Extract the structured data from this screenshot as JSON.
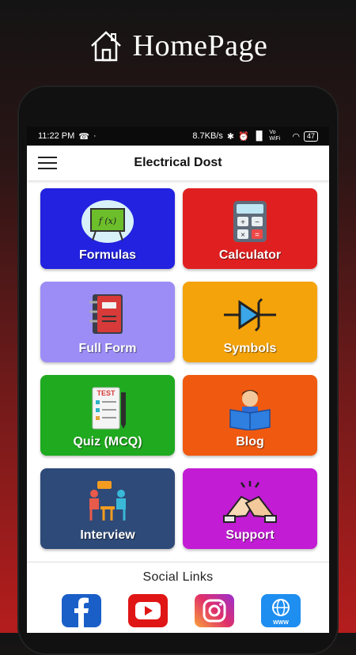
{
  "hero": {
    "title": "HomePage"
  },
  "status_bar": {
    "time": "11:22 PM",
    "speed": "8.7KB/s",
    "network": "Vo WiFi",
    "battery": "47"
  },
  "app_bar": {
    "title": "Electrical Dost"
  },
  "tiles": [
    {
      "label": "Formulas",
      "color": "#2222e0",
      "icon": "formula-board-icon"
    },
    {
      "label": "Calculator",
      "color": "#e02020",
      "icon": "calculator-icon"
    },
    {
      "label": "Full Form",
      "color": "#9b8df5",
      "icon": "notebook-icon"
    },
    {
      "label": "Symbols",
      "color": "#f5a30a",
      "icon": "diode-symbol-icon"
    },
    {
      "label": "Quiz (MCQ)",
      "color": "#1faa1f",
      "icon": "test-paper-icon"
    },
    {
      "label": "Blog",
      "color": "#f05a10",
      "icon": "reading-person-icon"
    },
    {
      "label": "Interview",
      "color": "#2e4a78",
      "icon": "interview-icon"
    },
    {
      "label": "Support",
      "color": "#c21cd4",
      "icon": "handshake-icon"
    }
  ],
  "social": {
    "title": "Social Links",
    "links": [
      {
        "icon": "facebook-icon",
        "color": "#1a5fc8"
      },
      {
        "icon": "youtube-icon",
        "color": "#e01515"
      },
      {
        "icon": "instagram-icon",
        "color": "#d6297a"
      },
      {
        "icon": "website-icon",
        "color": "#1e8ef0"
      }
    ]
  }
}
